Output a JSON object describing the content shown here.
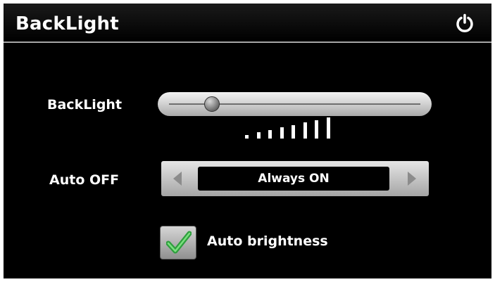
{
  "header": {
    "title": "BackLight",
    "power_icon": "power-icon"
  },
  "backlight": {
    "label": "BackLight",
    "slider_value": 0.17,
    "level_bars": 8
  },
  "auto_off": {
    "label": "Auto OFF",
    "selected": "Always ON",
    "prev_icon": "triangle-left-icon",
    "next_icon": "triangle-right-icon"
  },
  "auto_brightness": {
    "label": "Auto brightness",
    "checked": true,
    "check_icon": "checkmark-icon"
  },
  "colors": {
    "background": "#000000",
    "text": "#ffffff",
    "check": "#39b54a"
  }
}
